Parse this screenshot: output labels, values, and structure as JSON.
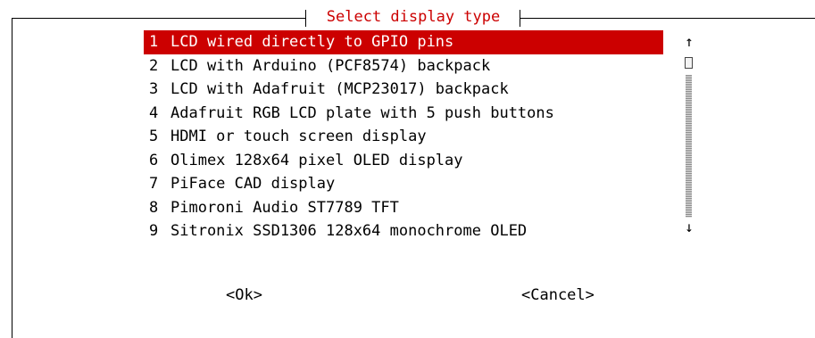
{
  "dialog": {
    "title": "Select display type",
    "items": [
      {
        "num": "1",
        "label": "LCD wired directly to GPIO pins",
        "selected": true
      },
      {
        "num": "2",
        "label": "LCD with Arduino (PCF8574) backpack"
      },
      {
        "num": "3",
        "label": "LCD with Adafruit (MCP23017) backpack"
      },
      {
        "num": "4",
        "label": "Adafruit RGB LCD plate with 5 push buttons"
      },
      {
        "num": "5",
        "label": "HDMI or touch screen display"
      },
      {
        "num": "6",
        "label": "Olimex 128x64 pixel OLED display"
      },
      {
        "num": "7",
        "label": "PiFace CAD display"
      },
      {
        "num": "8",
        "label": "Pimoroni Audio ST7789 TFT"
      },
      {
        "num": "9",
        "label": "Sitronix SSD1306 128x64 monochrome OLED"
      }
    ],
    "scroll": {
      "up": "↑",
      "down": "↓"
    },
    "buttons": {
      "ok": "<Ok>",
      "cancel": "<Cancel>"
    }
  },
  "colors": {
    "accent": "#cc0000",
    "background": "#ffffff",
    "text": "#000000"
  }
}
